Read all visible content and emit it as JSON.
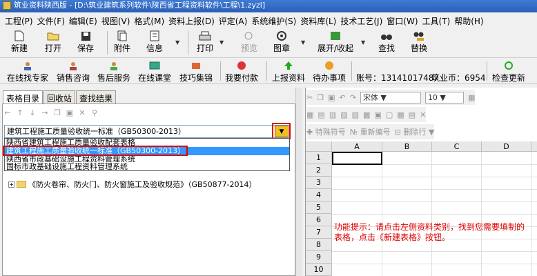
{
  "window": {
    "title": "筑业资料陕西版 - [D:\\筑业建筑系列软件\\陕西省工程资料软件\\工程\\1.zyzl]"
  },
  "menu": [
    "工程(P)",
    "文件(F)",
    "编辑(E)",
    "视图(V)",
    "格式(M)",
    "资料上报(D)",
    "评定(A)",
    "系统维护(S)",
    "资料库(L)",
    "技术工艺(J)",
    "窗口(W)",
    "工具(T)",
    "帮助(H)"
  ],
  "toolbar1": {
    "new": "新建",
    "open": "打开",
    "save": "保存",
    "attach": "附件",
    "info": "信息",
    "print": "打印",
    "preview": "预览",
    "chapter": "图章",
    "expand": "展开/收起",
    "find": "查找",
    "replace": "替换"
  },
  "toolbar2": {
    "expert": "在线找专家",
    "sales": "销售咨询",
    "service": "售后服务",
    "classroom": "在线课堂",
    "tips": "技巧集锦",
    "pay": "我要付款",
    "upload": "上报资料",
    "todo": "待办事项",
    "account": "账号：13141017487",
    "coins": "筑业币：6954",
    "update": "检查更新"
  },
  "tabs": [
    "表格目录",
    "回收站",
    "查找结果"
  ],
  "combo": {
    "value": "建筑工程施工质量验收统一标准（GB50300-2013）"
  },
  "dropdown": {
    "items": [
      "陕西省建筑工程施工质量验收配套表格",
      "建筑工程施工质量验收统一标准（GB50300-2013）",
      "陕西省市政基础设施工程资料管理系统",
      "国标市政基础设施工程资料管理系统"
    ]
  },
  "tree": {
    "item": "《防火卷帘、防火门、防火窗施工及验收规范》（GB50877-2014）"
  },
  "right_toolbar": {
    "font": "宋体",
    "size": "10",
    "special": "特殊符号",
    "renumber": "重新编号",
    "delete_row": "删除行"
  },
  "grid": {
    "columns": [
      "A",
      "B",
      "C",
      "D"
    ],
    "rows": [
      "1",
      "2",
      "3",
      "4",
      "5",
      "6",
      "7",
      "8",
      "9",
      "10"
    ]
  },
  "hint": "功能提示：请点击左侧资料类别，找到您需要填制的表格，点击《新建表格》按钮。"
}
